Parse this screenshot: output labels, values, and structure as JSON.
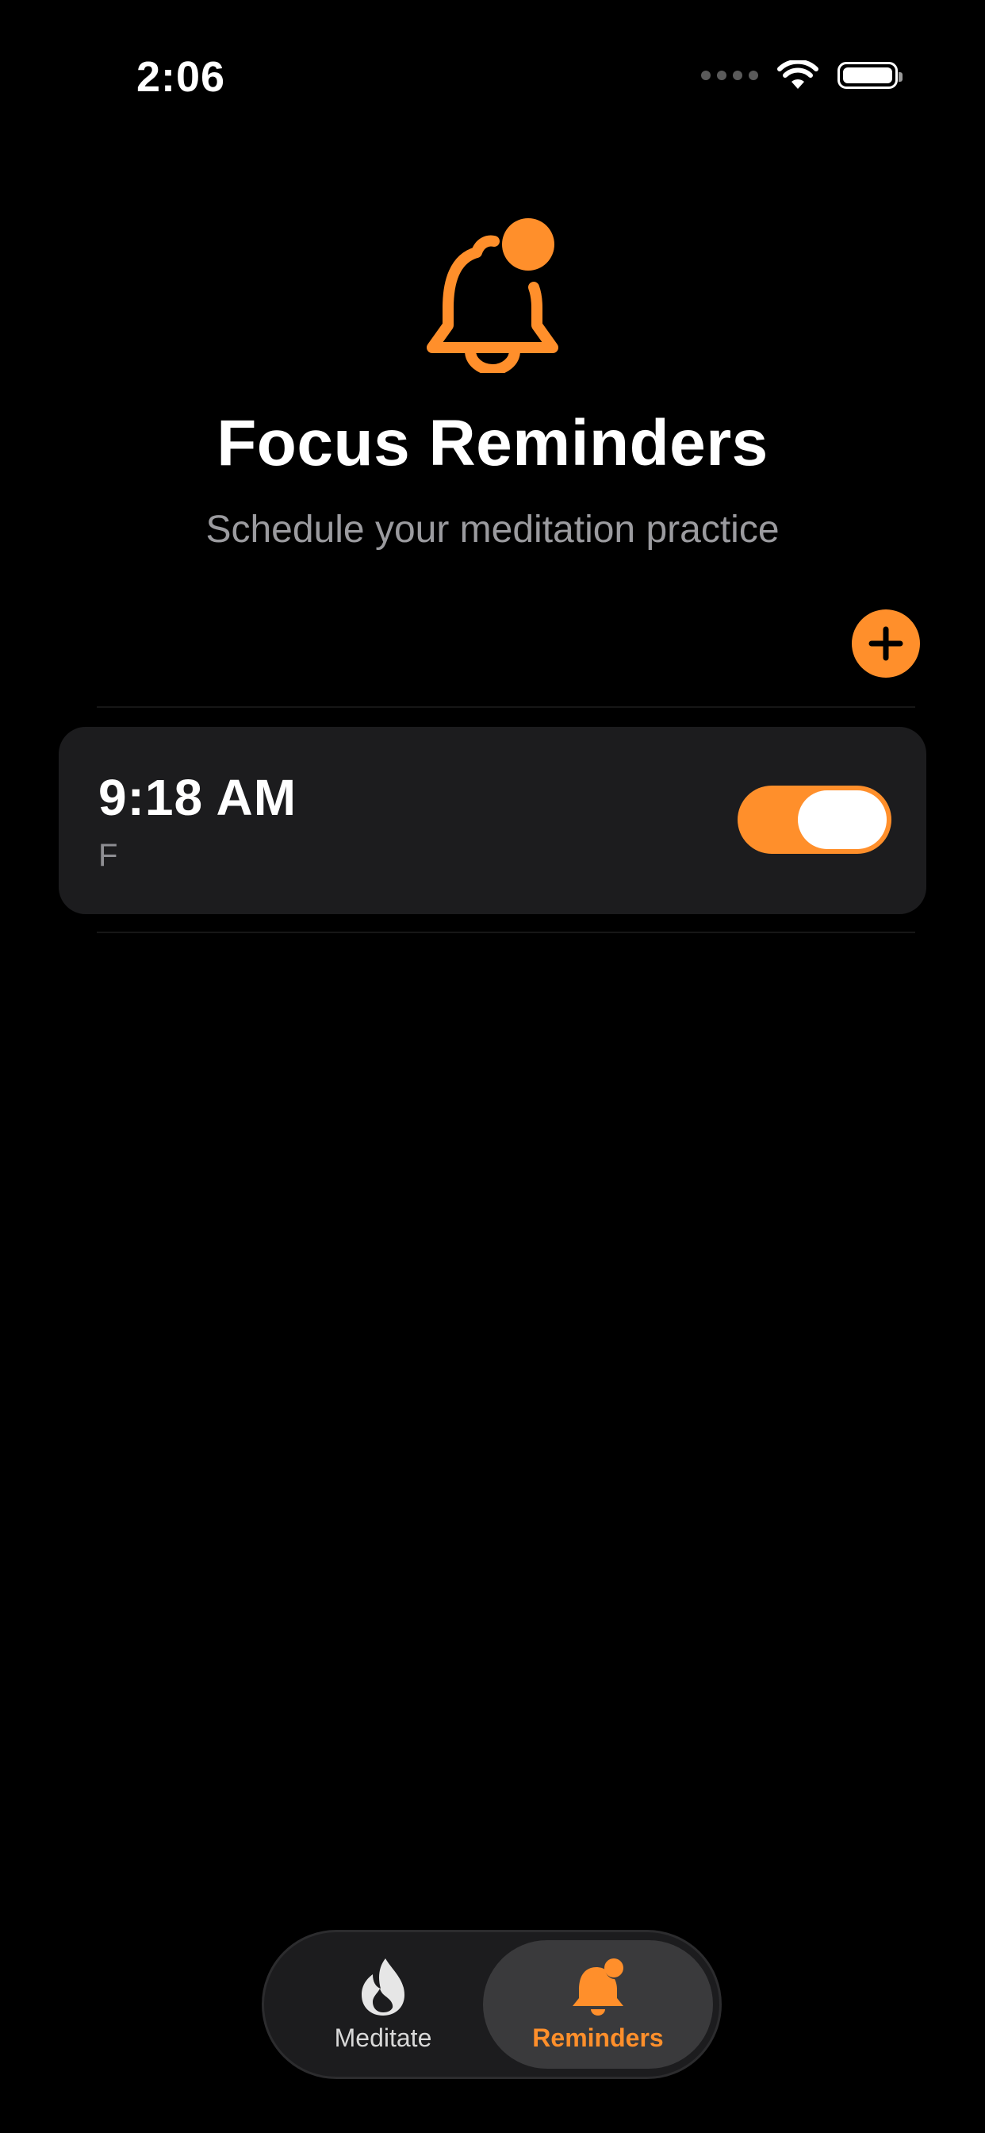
{
  "status_bar": {
    "time": "2:06"
  },
  "header": {
    "title": "Focus Reminders",
    "subtitle": "Schedule your meditation practice",
    "icon": "bell-badge-icon"
  },
  "reminders": [
    {
      "time": "9:18 AM",
      "days": "F",
      "enabled": true
    }
  ],
  "tab_bar": {
    "tabs": [
      {
        "label": "Meditate",
        "icon": "flame-icon",
        "selected": false
      },
      {
        "label": "Reminders",
        "icon": "bell-badge-icon",
        "selected": true
      }
    ]
  },
  "colors": {
    "accent": "#ff8f2b",
    "background": "#000000",
    "card": "#1c1c1e",
    "secondary_text": "#9b9b9f"
  }
}
